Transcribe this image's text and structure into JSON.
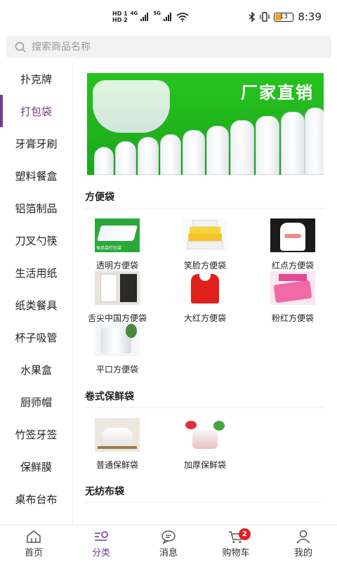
{
  "status_bar": {
    "hd1": "HD 1",
    "hd2": "HD 2",
    "net1": "4G",
    "net2": "5G",
    "battery": "13",
    "time": "8:39"
  },
  "search": {
    "placeholder": "搜索商品名称"
  },
  "sidebar": {
    "items": [
      {
        "label": "扑克牌"
      },
      {
        "label": "打包袋"
      },
      {
        "label": "牙膏牙刷"
      },
      {
        "label": "塑料餐盒"
      },
      {
        "label": "铝箔制品"
      },
      {
        "label": "刀叉勺筷"
      },
      {
        "label": "生活用纸"
      },
      {
        "label": "纸类餐具"
      },
      {
        "label": "杯子吸管"
      },
      {
        "label": "水果盒"
      },
      {
        "label": "厨师帽"
      },
      {
        "label": "竹签牙签"
      },
      {
        "label": "保鲜膜"
      },
      {
        "label": "桌布台布"
      }
    ],
    "active_index": 1
  },
  "banner": {
    "slogan": "厂家直销"
  },
  "sections": [
    {
      "title": "方便袋",
      "items": [
        {
          "name": "透明方便袋",
          "thumb_text": "食品袋打包袋"
        },
        {
          "name": "笑脸方便袋"
        },
        {
          "name": "红点方便袋"
        },
        {
          "name": "舌尖中国方便袋"
        },
        {
          "name": "大红方便袋"
        },
        {
          "name": "粉红方便袋"
        },
        {
          "name": "平口方便袋"
        }
      ]
    },
    {
      "title": "卷式保鲜袋",
      "items": [
        {
          "name": "普通保鲜袋"
        },
        {
          "name": "加厚保鲜袋"
        }
      ]
    },
    {
      "title": "无纺布袋",
      "items": []
    }
  ],
  "tabbar": {
    "items": [
      {
        "label": "首页",
        "icon": "home-icon"
      },
      {
        "label": "分类",
        "icon": "category-icon"
      },
      {
        "label": "消息",
        "icon": "message-icon"
      },
      {
        "label": "购物车",
        "icon": "cart-icon",
        "badge": "2"
      },
      {
        "label": "我的",
        "icon": "user-icon"
      }
    ],
    "active_index": 1
  },
  "colors": {
    "accent": "#7a3a8c",
    "badge": "#e02020",
    "banner_green": "#22b81e"
  }
}
